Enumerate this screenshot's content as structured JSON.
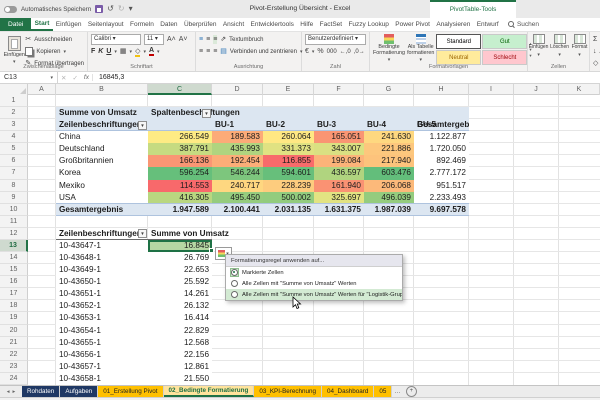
{
  "titlebar": {
    "autosave": "Automatisches Speichern",
    "title": "Pivot-Erstellung Übersicht - Excel",
    "contextual_tab": "PivotTable-Tools"
  },
  "menu": {
    "file": "Datei",
    "tabs": [
      "Start",
      "Einfügen",
      "Seitenlayout",
      "Formeln",
      "Daten",
      "Überprüfen",
      "Ansicht",
      "Entwicklertools",
      "Hilfe",
      "FactSet",
      "Fuzzy Lookup",
      "Power Pivot",
      "Analysieren",
      "Entwurf"
    ],
    "active_tab": "Start",
    "search": "Suchen"
  },
  "ribbon": {
    "clipboard": {
      "paste": "Einfügen",
      "cut": "Ausschneiden",
      "copy": "Kopieren",
      "painter": "Format übertragen",
      "group": "Zwischenablage"
    },
    "font": {
      "family": "Calibri",
      "size": "11",
      "bold": "F",
      "italic": "K",
      "underline": "U",
      "group": "Schriftart"
    },
    "align": {
      "wrap": "Textumbruch",
      "merge": "Verbinden und zentrieren",
      "group": "Ausrichtung"
    },
    "number": {
      "format": "Benutzerdefiniert",
      "group": "Zahl"
    },
    "styles": {
      "conditional": "Bedingte Formatierung",
      "astable": "Als Tabelle formatieren",
      "group": "Formatvorlagen",
      "gallery": [
        {
          "label": "Standard",
          "kind": "std"
        },
        {
          "label": "Gut",
          "kind": "good"
        },
        {
          "label": "Neutral",
          "kind": "neutral"
        },
        {
          "label": "Schlecht",
          "kind": "bad"
        }
      ]
    },
    "cells": {
      "insert": "Einfügen",
      "delete": "Löschen",
      "format": "Format",
      "group": "Zellen"
    },
    "editing": {
      "autosum": "AutoSumme",
      "fill": "Ausfüllen",
      "clear": "Löschen"
    }
  },
  "formula_bar": {
    "name_box": "C13",
    "fx": "fx",
    "value": "16845,3"
  },
  "sheet": {
    "col_letters": [
      "A",
      "B",
      "C",
      "D",
      "E",
      "F",
      "G",
      "H",
      "I",
      "J",
      "K"
    ],
    "row_count": 24,
    "selected_col": 3,
    "selected_row": 13
  },
  "pivot": {
    "value_title": "Summe von Umsatz",
    "col_field": "Spaltenbeschriftungen",
    "row_field": "Zeilenbeschriftungen",
    "columns": [
      "BU-1",
      "BU-2",
      "BU-3",
      "BU-4",
      "BU-5"
    ],
    "grand_col_label": "Gesamtergebnis",
    "grand_row_label": "Gesamtergebnis",
    "rows": [
      {
        "label": "China",
        "values": [
          266549,
          189583,
          260064,
          165051,
          241630
        ],
        "total": 1122877
      },
      {
        "label": "Deutschland",
        "values": [
          387791,
          435993,
          331373,
          343007,
          221886
        ],
        "total": 1720050
      },
      {
        "label": "Großbritannien",
        "values": [
          166136,
          192454,
          116855,
          199084,
          217940
        ],
        "total": 892469
      },
      {
        "label": "Korea",
        "values": [
          596254,
          546244,
          594601,
          436597,
          603476
        ],
        "total": 2777172
      },
      {
        "label": "Mexiko",
        "values": [
          114553,
          240717,
          228239,
          161940,
          206068
        ],
        "total": 951517
      },
      {
        "label": "USA",
        "values": [
          416305,
          495450,
          500002,
          325697,
          496039
        ],
        "total": 2233493
      }
    ],
    "grand_row": {
      "values": [
        1947589,
        2100441,
        2031135,
        1631375,
        1987039
      ],
      "total": 9697578
    }
  },
  "list": {
    "row_field": "Zeilenbeschriftungen",
    "value_title": "Summe von Umsatz",
    "rows": [
      {
        "id": "10-43647-1",
        "value": 16845
      },
      {
        "id": "10-43648-1",
        "value": 26769
      },
      {
        "id": "10-43649-1",
        "value": 22653
      },
      {
        "id": "10-43650-1",
        "value": 25592
      },
      {
        "id": "10-43651-1",
        "value": 14261
      },
      {
        "id": "10-43652-1",
        "value": 26132
      },
      {
        "id": "10-43653-1",
        "value": 16414
      },
      {
        "id": "10-43654-1",
        "value": 22829
      },
      {
        "id": "10-43655-1",
        "value": 12568
      },
      {
        "id": "10-43656-1",
        "value": 22156
      },
      {
        "id": "10-43657-1",
        "value": 12861
      },
      {
        "id": "10-43658-1",
        "value": 21550
      }
    ]
  },
  "popup": {
    "title": "Formatierungsregel anwenden auf...",
    "options": [
      "Markierte Zellen",
      "Alle Zellen mit \"Summe von Umsatz\" Werten",
      "Alle Zellen mit \"Summe von Umsatz\" Werten für \"Logistik-Gruppe\""
    ],
    "selected_index": 0,
    "hovered_index": 2
  },
  "sheet_tabs": [
    {
      "label": "Rohdaten",
      "kind": "navy"
    },
    {
      "label": "Aufgaben",
      "kind": "navy"
    },
    {
      "label": "01_Erstellung Pivot",
      "kind": "amber"
    },
    {
      "label": "02_Bedingte Formatierung",
      "kind": "active"
    },
    {
      "label": "03_KPI-Berechnung",
      "kind": "amber"
    },
    {
      "label": "04_Dashboard",
      "kind": "amber"
    },
    {
      "label": "05",
      "kind": "amber"
    }
  ],
  "tab_overflow": "…",
  "colors": {
    "scale_min": "#F8696B",
    "scale_mid": "#FFEB84",
    "scale_max": "#63BE7B",
    "pivot_header": "#dce6f1",
    "selected_cell_fill": "#b5d7a3",
    "accent_green": "#217346",
    "tab_navy": "#1f3864",
    "tab_amber": "#ffc000",
    "good_bg": "#c6efce",
    "good_fg": "#006100",
    "neutral_bg": "#ffeb9c",
    "neutral_fg": "#9c6500",
    "bad_bg": "#ffc7ce",
    "bad_fg": "#9c0006"
  }
}
